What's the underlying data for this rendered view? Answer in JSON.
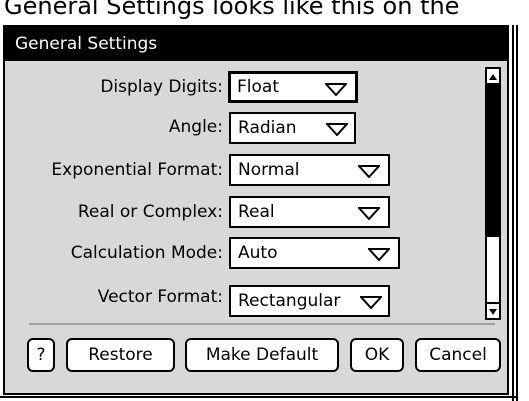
{
  "caption": "General Settings looks like this on the",
  "dialog": {
    "title": "General Settings",
    "fields": [
      {
        "label": "Display Digits:",
        "value": "Float"
      },
      {
        "label": "Angle:",
        "value": "Radian"
      },
      {
        "label": "Exponential Format:",
        "value": "Normal"
      },
      {
        "label": "Real or Complex:",
        "value": "Real"
      },
      {
        "label": "Calculation Mode:",
        "value": "Auto"
      },
      {
        "label": "Vector Format:",
        "value": "Rectangular"
      }
    ],
    "buttons": {
      "help": "?",
      "restore": "Restore",
      "make_default": "Make Default",
      "ok": "OK",
      "cancel": "Cancel"
    },
    "scrollbar": {
      "up_icon": "triangle-up-icon",
      "down_icon": "triangle-down-icon"
    }
  }
}
